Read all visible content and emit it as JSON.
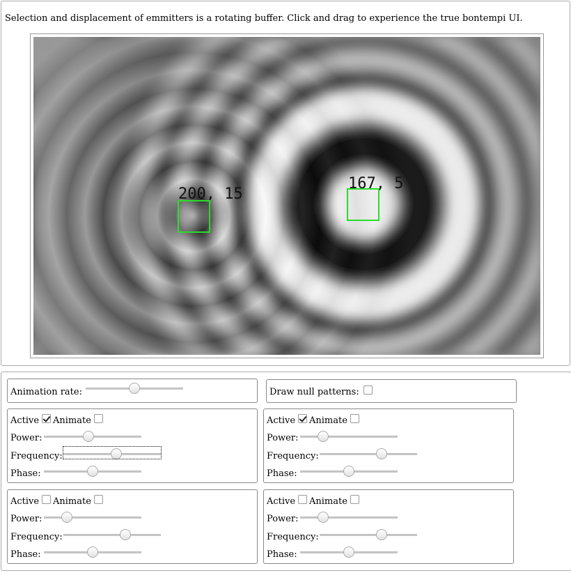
{
  "instructions": "Selection and displacement of emmitters is a rotating buffer. Click and drag to experience the true bontempi UI.",
  "emitter_labels": [
    "200, 15",
    "167, 5"
  ],
  "animation_rate_label": "Animation rate:",
  "animation_rate": 0.5,
  "draw_null_label": "Draw null patterns:",
  "draw_null_checked": false,
  "emitters": [
    {
      "active_label": "Active",
      "animate_label": "Animate",
      "active": true,
      "animate": false,
      "power_label": "Power:",
      "frequency_label": "Frequency:",
      "phase_label": "Phase:",
      "power": 0.45,
      "frequency": 0.55,
      "phase": 0.5
    },
    {
      "active_label": "Active",
      "animate_label": "Animate",
      "active": true,
      "animate": false,
      "power_label": "Power:",
      "frequency_label": "Frequency:",
      "phase_label": "Phase:",
      "power": 0.2,
      "frequency": 0.65,
      "phase": 0.5
    },
    {
      "active_label": "Active",
      "animate_label": "Animate",
      "active": false,
      "animate": false,
      "power_label": "Power:",
      "frequency_label": "Frequency:",
      "phase_label": "Phase:",
      "power": 0.2,
      "frequency": 0.65,
      "phase": 0.5
    },
    {
      "active_label": "Active",
      "animate_label": "Animate",
      "active": false,
      "animate": false,
      "power_label": "Power:",
      "frequency_label": "Frequency:",
      "phase_label": "Phase:",
      "power": 0.2,
      "frequency": 0.65,
      "phase": 0.5
    }
  ]
}
